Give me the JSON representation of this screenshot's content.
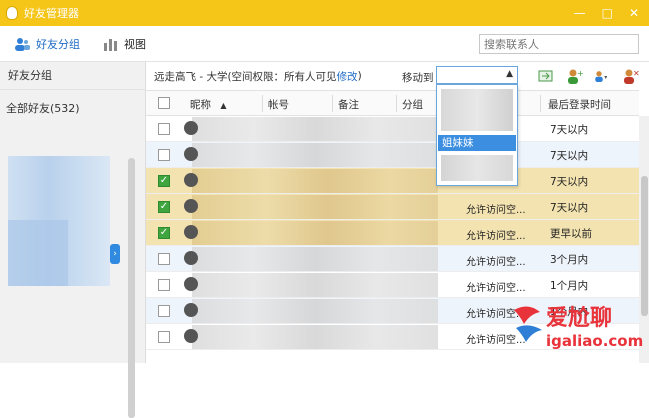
{
  "window": {
    "title": "好友管理器",
    "minimize": "—",
    "maximize": "□",
    "close": "✕"
  },
  "toolbar": {
    "group_tab": "好友分组",
    "view_tab": "视图",
    "search_placeholder": "搜索联系人"
  },
  "sidebar": {
    "header": "好友分组",
    "all_friends": "全部好友(532)"
  },
  "info": {
    "path": "远走高飞 - 大学(空间权限：所有人可见",
    "modify_link": "修改",
    "close_paren": ")",
    "move_to_label": "移动到"
  },
  "table": {
    "columns": {
      "nickname": "昵称",
      "sort_arrow": "▲",
      "account": "帐号",
      "remark": "备注",
      "group": "分组",
      "last_login": "最后登录时间"
    },
    "rows": [
      {
        "checked": false,
        "remark": "",
        "last_login": "7天以内",
        "state": "normal"
      },
      {
        "checked": false,
        "remark": "",
        "last_login": "7天以内",
        "state": "alt"
      },
      {
        "checked": true,
        "remark": "",
        "last_login": "7天以内",
        "state": "sel"
      },
      {
        "checked": true,
        "remark": "允许访问空...",
        "last_login": "7天以内",
        "state": "sel"
      },
      {
        "checked": true,
        "remark": "允许访问空...",
        "last_login": "更早以前",
        "state": "sel"
      },
      {
        "checked": false,
        "remark": "允许访问空...",
        "last_login": "3个月内",
        "state": "alt"
      },
      {
        "checked": false,
        "remark": "允许访问空...",
        "last_login": "1个月内",
        "state": "normal"
      },
      {
        "checked": false,
        "remark": "允许访问空...",
        "last_login": "1个月内",
        "state": "alt"
      },
      {
        "checked": false,
        "remark": "允许访问空...",
        "last_login": "",
        "state": "normal"
      }
    ]
  },
  "dropdown": {
    "highlighted_item": "姐妹妹"
  },
  "watermark": {
    "main": "爱尬聊",
    "sub": "igaliao.com"
  },
  "colors": {
    "titlebar": "#f5c518",
    "accent": "#1e6ac4",
    "selected_row": "#f3e3b0",
    "checkbox_checked": "#3fa63f"
  }
}
